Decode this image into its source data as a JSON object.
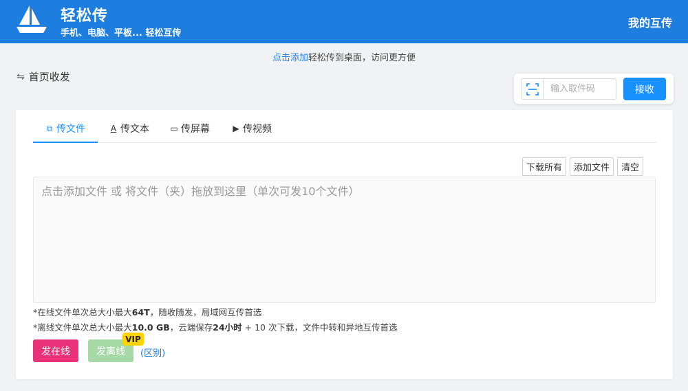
{
  "header": {
    "title": "轻松传",
    "subtitle": "手机、电脑、平板... 轻松互传",
    "my_link": "我的互传"
  },
  "tip": {
    "link": "点击添加",
    "text": "轻松传到桌面，访问更方便"
  },
  "breadcrumb": {
    "icon": "swap-arrows-icon",
    "label": "首页收发"
  },
  "receive": {
    "scan_icon": "scan-icon",
    "placeholder": "输入取件码",
    "button": "接收"
  },
  "tabs": [
    {
      "label": "传文件",
      "icon": "files-icon",
      "active": true
    },
    {
      "label": "传文本",
      "icon": "text-icon",
      "active": false
    },
    {
      "label": "传屏幕",
      "icon": "screen-icon",
      "active": false
    },
    {
      "label": "传视频",
      "icon": "video-camera-icon",
      "active": false
    }
  ],
  "actions": {
    "download_all": "下载所有",
    "add_file": "添加文件",
    "clear": "清空"
  },
  "dropzone": {
    "text": "点击添加文件 或 将文件（夹）拖放到这里（单次可发10个文件）"
  },
  "notes": {
    "online_pre": "*在线文件单次总大小最大",
    "online_size": "64T",
    "online_post": "，随收随发，局域网互传首选",
    "offline_pre": "*离线文件单次总大小最大",
    "offline_size": "10.0 GB",
    "offline_mid": "，云端保存",
    "offline_hours": "24小时",
    "offline_post": " + 10 次下载，文件中转和异地互传首选"
  },
  "buttons": {
    "send_online": "发在线",
    "send_offline": "发离线",
    "vip_badge": "VIP",
    "difference_link": "(区别)"
  },
  "colors": {
    "header_bg": "#1e7ee0",
    "primary": "#1890ff",
    "send_online": "#e9327a",
    "send_offline": "#a6d9a6",
    "vip": "#ffd400"
  }
}
